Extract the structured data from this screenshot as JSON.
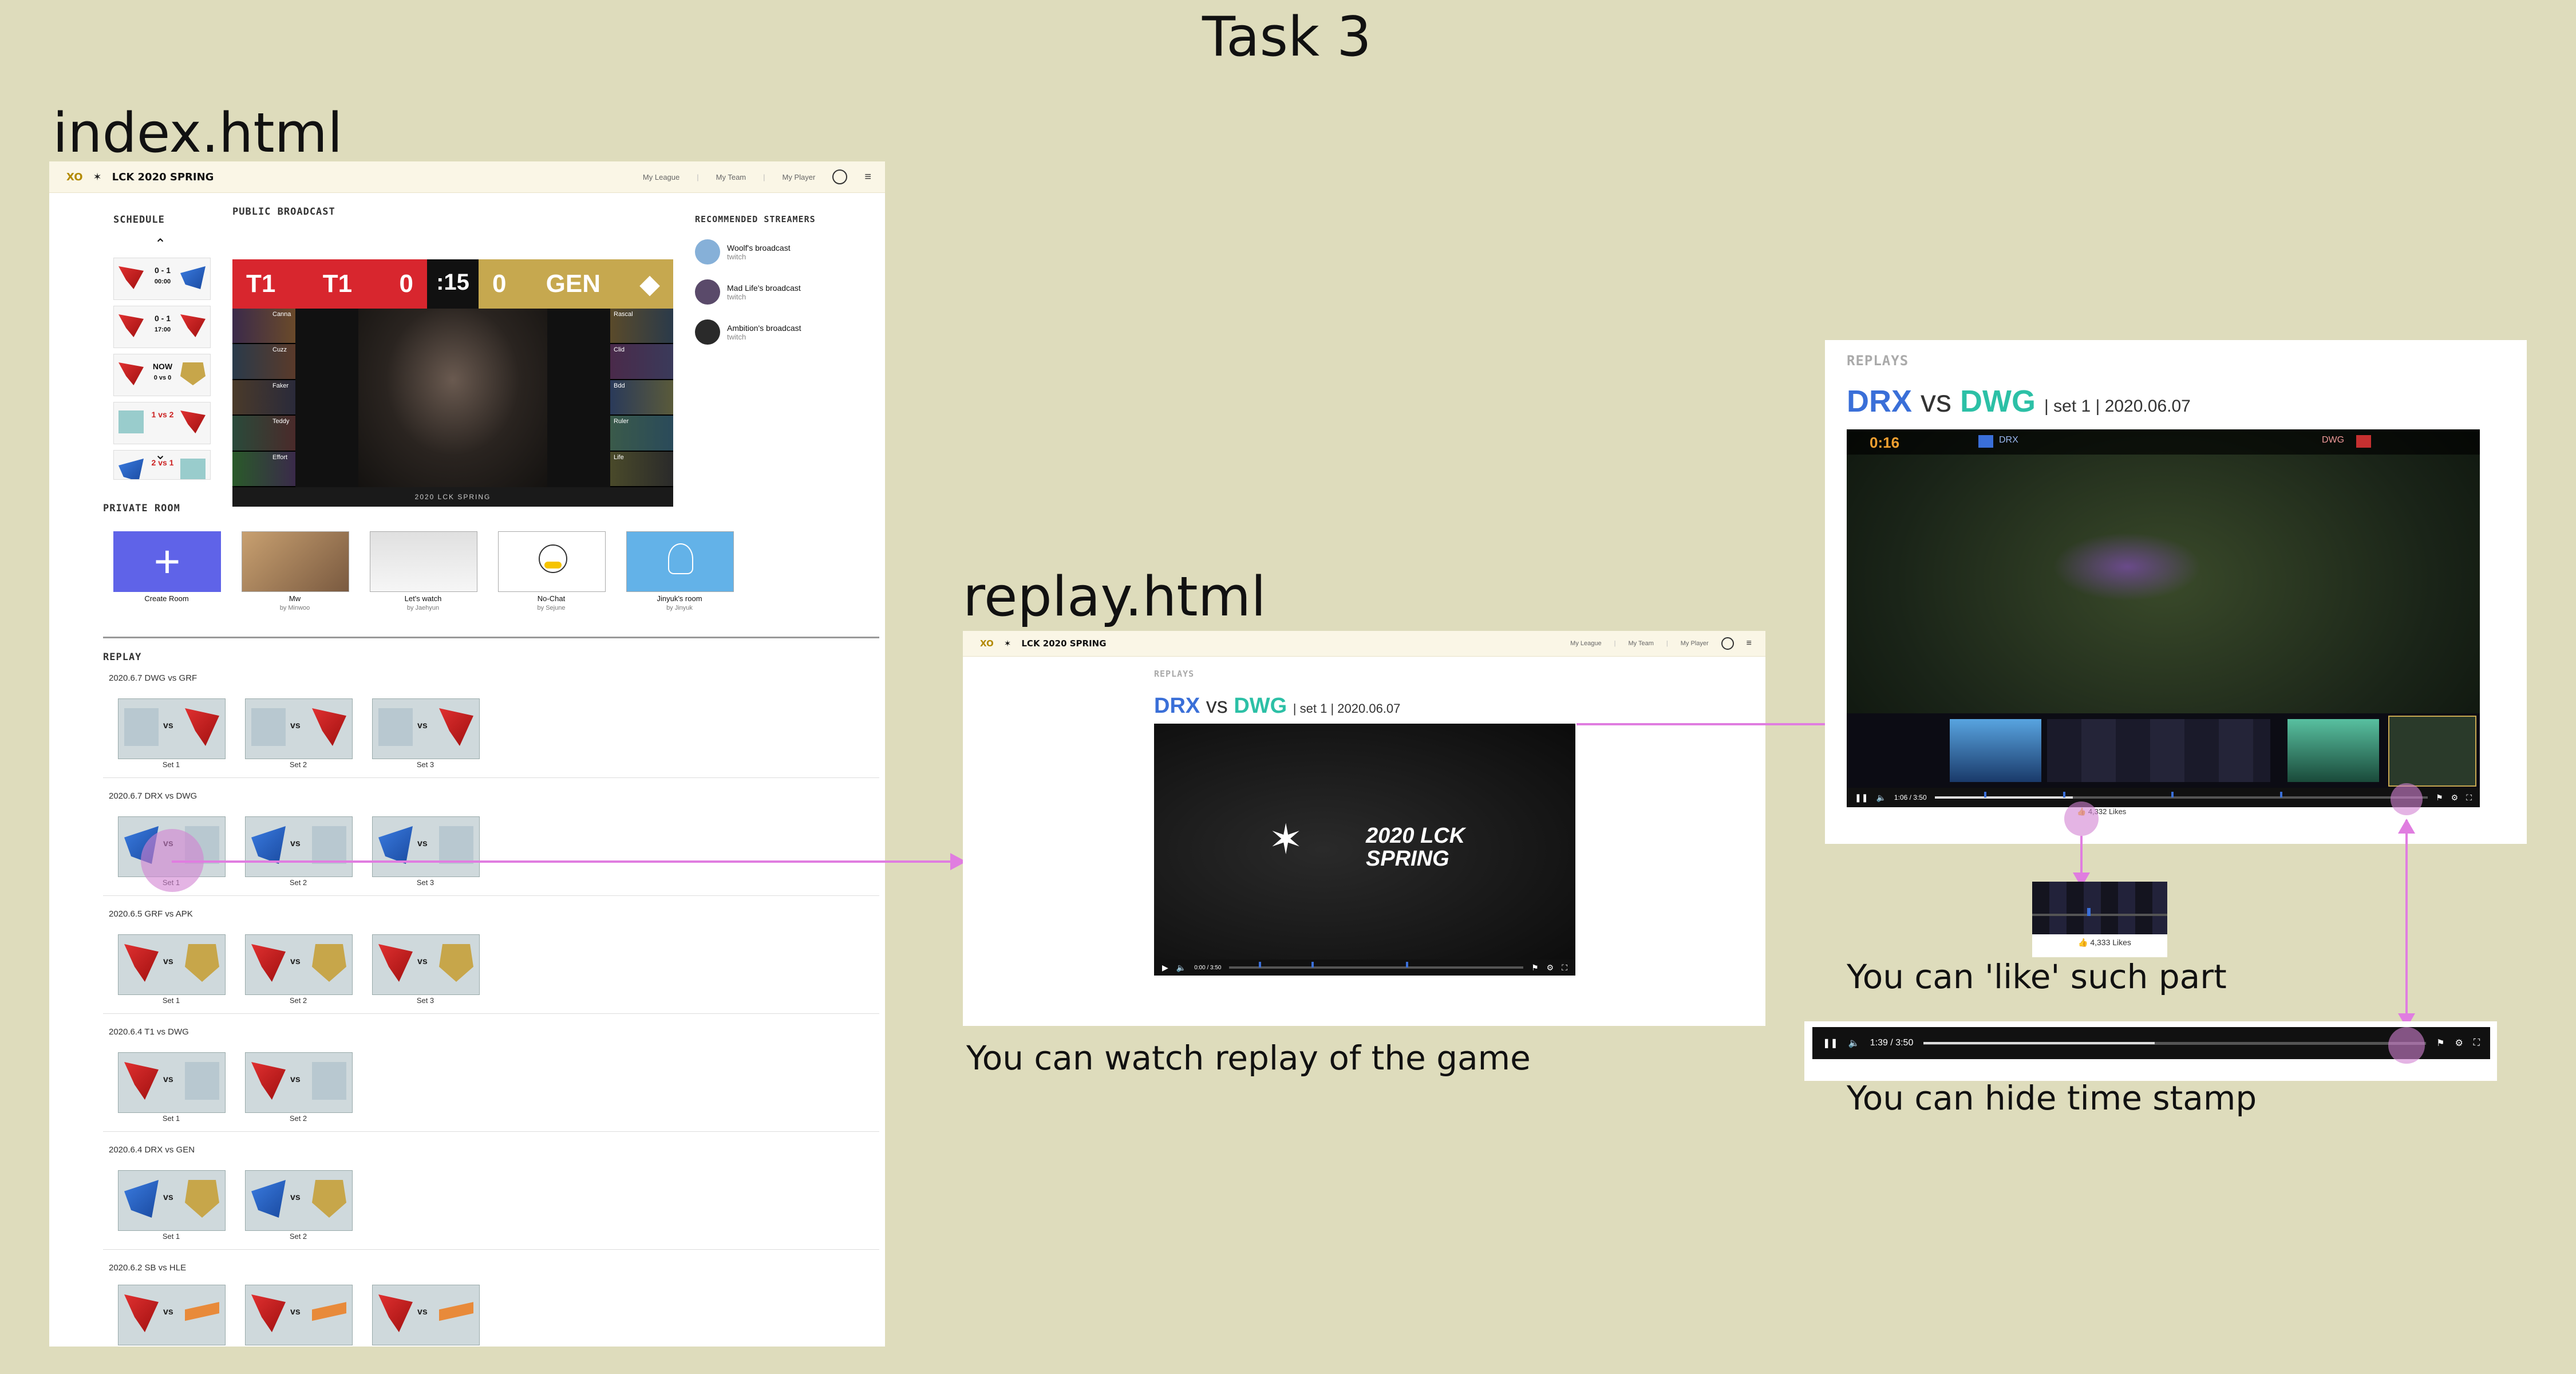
{
  "title": "Task 3",
  "index": {
    "label": "index.html",
    "nav": {
      "logo_xo": "XO",
      "logo_text": "LCK 2020 SPRING",
      "links": [
        "My League",
        "My Team",
        "My Player"
      ]
    },
    "schedule": {
      "title": "SCHEDULE",
      "items": [
        {
          "score": "0 - 1",
          "sub": "00:00"
        },
        {
          "score": "0 - 1",
          "sub": "17:00"
        },
        {
          "score": "NOW",
          "sub": "0 vs 0"
        },
        {
          "score": "1 vs 2",
          "sub": ""
        },
        {
          "score": "2 vs 1",
          "sub": ""
        }
      ]
    },
    "broadcast": {
      "title": "PUBLIC BROADCAST",
      "left_team": "T1",
      "left_score": "0",
      "timer": ":15",
      "right_score": "0",
      "right_team": "GEN",
      "footer": "2020 LCK SPRING",
      "left_players": [
        "Canna",
        "Cuzz",
        "Faker",
        "Teddy",
        "Effort"
      ],
      "right_players": [
        "Rascal",
        "Clid",
        "Bdd",
        "Ruler",
        "Life"
      ]
    },
    "streamers": {
      "title": "RECOMMENDED STREAMERS",
      "items": [
        {
          "name": "Woolf's broadcast",
          "platform": "twitch"
        },
        {
          "name": "Mad Life's broadcast",
          "platform": "twitch"
        },
        {
          "name": "Ambition's broadcast",
          "platform": "twitch"
        }
      ]
    },
    "private_room": {
      "title": "PRIVATE ROOM",
      "rooms": [
        {
          "label": "Create Room",
          "sub": ""
        },
        {
          "label": "Mw",
          "sub": "by Minwoo"
        },
        {
          "label": "Let's watch",
          "sub": "by Jaehyun"
        },
        {
          "label": "No-Chat",
          "sub": "by Sejune"
        },
        {
          "label": "Jinyuk's room",
          "sub": "by Jinyuk"
        }
      ]
    },
    "replay": {
      "title": "REPLAY",
      "groups": [
        {
          "title": "2020.6.7 DWG vs GRF",
          "sets": [
            "Set 1",
            "Set 2",
            "Set 3"
          ]
        },
        {
          "title": "2020.6.7 DRX vs DWG",
          "sets": [
            "Set 1",
            "Set 2",
            "Set 3"
          ]
        },
        {
          "title": "2020.6.5 GRF vs APK",
          "sets": [
            "Set 1",
            "Set 2",
            "Set 3"
          ]
        },
        {
          "title": "2020.6.4 T1 vs DWG",
          "sets": [
            "Set 1",
            "Set 2"
          ]
        },
        {
          "title": "2020.6.4 DRX vs GEN",
          "sets": [
            "Set 1",
            "Set 2"
          ]
        },
        {
          "title": "2020.6.2 SB vs HLE",
          "sets": [
            "",
            "",
            ""
          ]
        }
      ]
    }
  },
  "replay_page": {
    "label": "replay.html",
    "section": "REPLAYS",
    "team_a": "DRX",
    "vs": "vs",
    "team_b": "DWG",
    "set": "set 1",
    "date": "2020.06.07",
    "video_title": "2020 LCK SPRING",
    "time": "0:00 / 3:50",
    "caption": "You can watch replay of the game"
  },
  "detail": {
    "section": "REPLAYS",
    "team_a": "DRX",
    "vs": "vs",
    "team_b": "DWG",
    "set": "set 1",
    "date": "2020.06.07",
    "game_timer": "0:16",
    "time": "1:06 / 3:50",
    "likes_small": "4,332 Likes",
    "likes_popup": "4,333 Likes",
    "like_caption": "You can 'like' such part",
    "bar_time": "1:39 / 3:50",
    "timestamp_caption": "You can hide time stamp"
  },
  "colors": {
    "background": "#dedcbc",
    "arrow": "#e07de0",
    "drx": "#3a6fd8",
    "dwg": "#2cc0a6"
  }
}
